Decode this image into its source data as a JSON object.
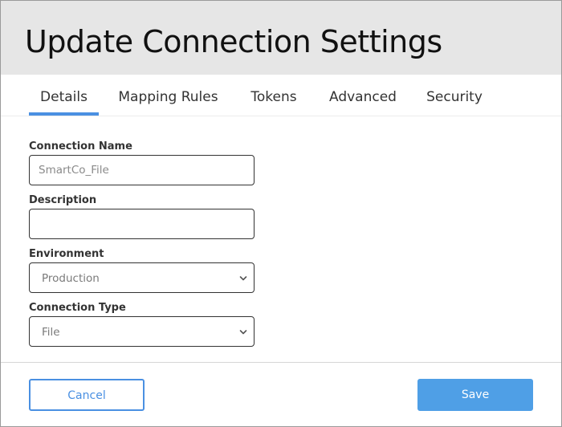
{
  "dialog": {
    "title": "Update Connection Settings"
  },
  "tabs": [
    {
      "label": "Details",
      "active": true
    },
    {
      "label": "Mapping Rules",
      "active": false
    },
    {
      "label": "Tokens",
      "active": false
    },
    {
      "label": "Advanced",
      "active": false
    },
    {
      "label": "Security",
      "active": false
    }
  ],
  "form": {
    "connection_name": {
      "label": "Connection Name",
      "value": "",
      "placeholder": "SmartCo_File"
    },
    "description": {
      "label": "Description",
      "value": "",
      "placeholder": ""
    },
    "environment": {
      "label": "Environment",
      "selected": "Production"
    },
    "connection_type": {
      "label": "Connection Type",
      "selected": "File"
    }
  },
  "footer": {
    "cancel_label": "Cancel",
    "save_label": "Save"
  },
  "icons": {
    "select_arrow": "chevron-down-icon"
  },
  "colors": {
    "accent": "#4a90e2",
    "save_button": "#4f9fe6",
    "header_bg": "#e6e6e6"
  }
}
